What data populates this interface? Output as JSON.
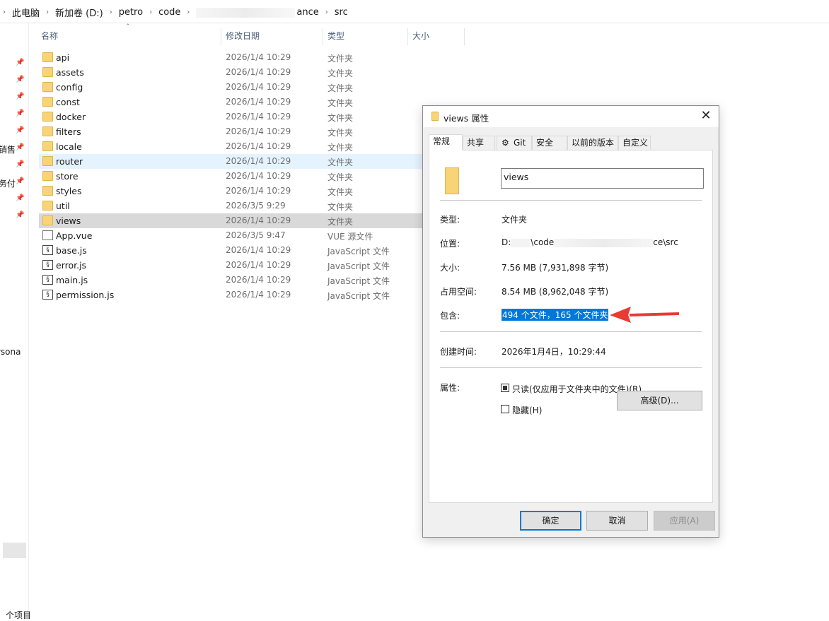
{
  "address": {
    "crumbs": [
      "此电脑",
      "新加卷 (D:)",
      "petro",
      "code",
      "ance",
      "src"
    ]
  },
  "nav": {
    "left_texts": [
      "销售",
      "务付",
      "rsona"
    ],
    "status": "个项目"
  },
  "columns": {
    "name": "名称",
    "date": "修改日期",
    "type": "类型",
    "size": "大小"
  },
  "files": [
    {
      "name": "api",
      "date": "2026/1/4 10:29",
      "type": "文件夹",
      "icon": "folder-icon"
    },
    {
      "name": "assets",
      "date": "2026/1/4 10:29",
      "type": "文件夹",
      "icon": "folder-icon"
    },
    {
      "name": "config",
      "date": "2026/1/4 10:29",
      "type": "文件夹",
      "icon": "folder-icon"
    },
    {
      "name": "const",
      "date": "2026/1/4 10:29",
      "type": "文件夹",
      "icon": "folder-icon"
    },
    {
      "name": "docker",
      "date": "2026/1/4 10:29",
      "type": "文件夹",
      "icon": "folder-icon"
    },
    {
      "name": "filters",
      "date": "2026/1/4 10:29",
      "type": "文件夹",
      "icon": "folder-icon"
    },
    {
      "name": "locale",
      "date": "2026/1/4 10:29",
      "type": "文件夹",
      "icon": "folder-icon"
    },
    {
      "name": "router",
      "date": "2026/1/4 10:29",
      "type": "文件夹",
      "icon": "folder-icon"
    },
    {
      "name": "store",
      "date": "2026/1/4 10:29",
      "type": "文件夹",
      "icon": "folder-icon"
    },
    {
      "name": "styles",
      "date": "2026/1/4 10:29",
      "type": "文件夹",
      "icon": "folder-icon"
    },
    {
      "name": "util",
      "date": "2026/3/5 9:29",
      "type": "文件夹",
      "icon": "folder-icon"
    },
    {
      "name": "views",
      "date": "2026/1/4 10:29",
      "type": "文件夹",
      "icon": "folder-icon"
    },
    {
      "name": "App.vue",
      "date": "2026/3/5 9:47",
      "type": "VUE 源文件",
      "icon": "vue-file-icon"
    },
    {
      "name": "base.js",
      "date": "2026/1/4 10:29",
      "type": "JavaScript 文件",
      "icon": "js-file-icon"
    },
    {
      "name": "error.js",
      "date": "2026/1/4 10:29",
      "type": "JavaScript 文件",
      "icon": "js-file-icon"
    },
    {
      "name": "main.js",
      "date": "2026/1/4 10:29",
      "type": "JavaScript 文件",
      "icon": "js-file-icon"
    },
    {
      "name": "permission.js",
      "date": "2026/1/4 10:29",
      "type": "JavaScript 文件",
      "icon": "js-file-icon"
    }
  ],
  "hovered_row": "router",
  "selected_row": "views",
  "dialog": {
    "title": "views 属性",
    "tabs": [
      "常规",
      "共享",
      "Git",
      "安全",
      "以前的版本",
      "自定义"
    ],
    "active_tab": "常规",
    "folder_name": "views",
    "type_label": "类型:",
    "type_value": "文件夹",
    "location_label": "位置:",
    "location_start": "D:",
    "location_mid": "\\code",
    "location_end": "ce\\src",
    "size_label": "大小:",
    "size_value": "7.56 MB (7,931,898 字节)",
    "disk_label": "占用空间:",
    "disk_value": "8.54 MB (8,962,048 字节)",
    "contains_label": "包含:",
    "contains_value": "494 个文件，165 个文件夹",
    "created_label": "创建时间:",
    "created_value": "2026年1月4日，10:29:44",
    "attrs_label": "属性:",
    "readonly_label": "只读(仅应用于文件夹中的文件)(R)",
    "readonly_state": "indeterminate",
    "hidden_label": "隐藏(H)",
    "hidden_state": "unchecked",
    "advanced_label": "高级(D)...",
    "ok_label": "确定",
    "cancel_label": "取消",
    "apply_label": "应用(A)",
    "arrow_color": "#e83b34",
    "highlight_color": "#0078d7"
  }
}
